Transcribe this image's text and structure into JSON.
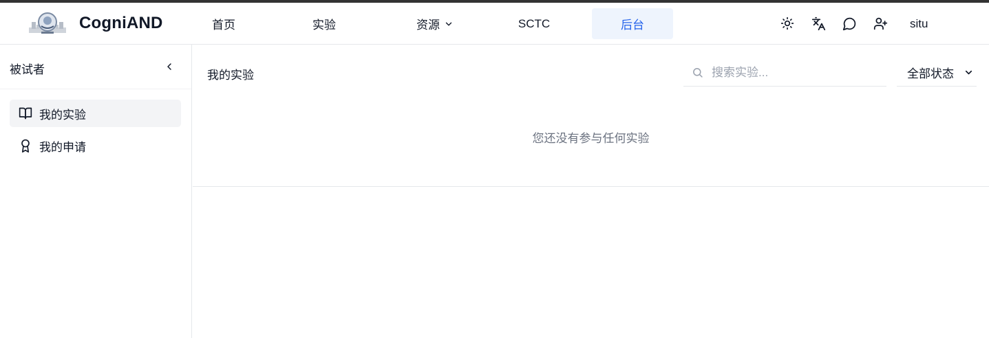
{
  "header": {
    "brand": "CogniAND",
    "nav": [
      {
        "label": "首页"
      },
      {
        "label": "实验"
      },
      {
        "label": "资源"
      },
      {
        "label": "SCTC"
      },
      {
        "label": "后台",
        "active": true
      }
    ],
    "icons": [
      "sun-icon",
      "translate-icon",
      "chat-icon",
      "user-plus-icon"
    ],
    "user": "situ"
  },
  "sidebar": {
    "title": "被试者",
    "items": [
      {
        "label": "我的实验",
        "icon": "book-open-icon",
        "active": true
      },
      {
        "label": "我的申请",
        "icon": "award-icon",
        "active": false
      }
    ]
  },
  "main": {
    "title": "我的实验",
    "search_placeholder": "搜索实验...",
    "status_filter": "全部状态",
    "empty_message": "您还没有参与任何实验"
  },
  "colors": {
    "accent": "#2563eb",
    "active_nav_bg": "#eef4fd",
    "active_sidebar_bg": "#f3f4f6",
    "top_stripe": "#333333"
  }
}
